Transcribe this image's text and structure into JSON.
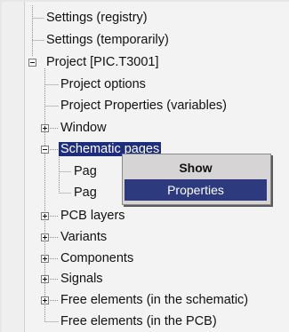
{
  "tree": {
    "items": [
      {
        "label": "Settings (registry)",
        "expander": "none",
        "selected": false
      },
      {
        "label": "Settings (temporarily)",
        "expander": "none",
        "selected": false
      },
      {
        "label": "Project [PIC.T3001]",
        "expander": "minus",
        "selected": false
      },
      {
        "label": "Project options",
        "expander": "none",
        "selected": false
      },
      {
        "label": "Project Properties (variables)",
        "expander": "none",
        "selected": false
      },
      {
        "label": "Window",
        "expander": "plus",
        "selected": false
      },
      {
        "label": "Schematic pages",
        "expander": "minus",
        "selected": true
      },
      {
        "label": "Pag",
        "expander": "none",
        "selected": false
      },
      {
        "label": "Pag",
        "expander": "none",
        "selected": false
      },
      {
        "label": "PCB layers",
        "expander": "plus",
        "selected": false
      },
      {
        "label": "Variants",
        "expander": "plus",
        "selected": false
      },
      {
        "label": "Components",
        "expander": "plus",
        "selected": false
      },
      {
        "label": "Signals",
        "expander": "plus",
        "selected": false
      },
      {
        "label": "Free elements (in the schematic)",
        "expander": "plus",
        "selected": false
      },
      {
        "label": "Free elements (in the PCB)",
        "expander": "none",
        "selected": false
      }
    ]
  },
  "context_menu": {
    "items": [
      {
        "label": "Show",
        "bold": true,
        "highlighted": false
      },
      {
        "label": "Properties",
        "bold": false,
        "highlighted": true
      }
    ]
  },
  "colors": {
    "selection": "#1d2d7c",
    "menu_highlight": "#2d3a7e",
    "menu_background": "#d6d4d5"
  }
}
